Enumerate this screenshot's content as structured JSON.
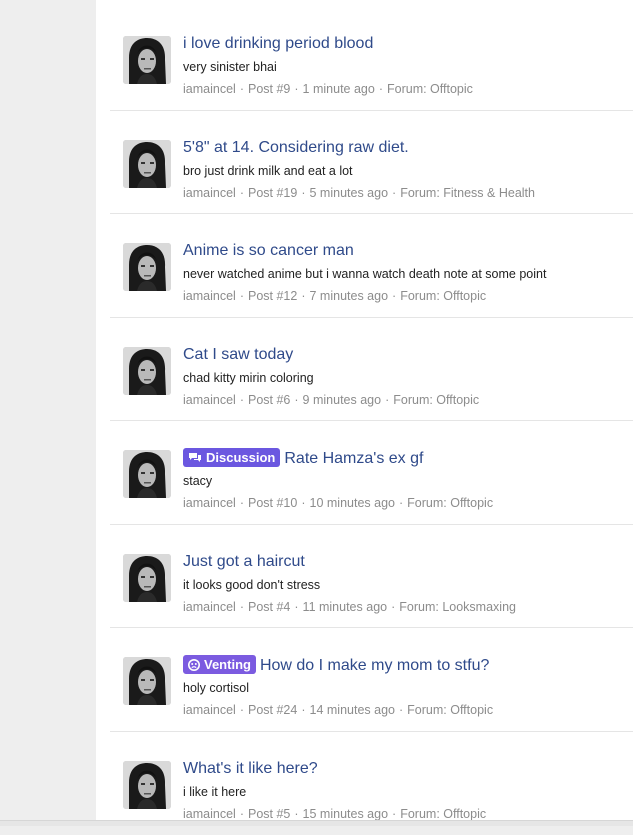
{
  "badge_colors": {
    "discussion": "#6b57e0",
    "venting": "#7b5be0"
  },
  "posts": [
    {
      "title": "i love drinking period blood",
      "snippet": "very sinister bhai",
      "author": "iamaincel",
      "post_number": "Post #9",
      "time": "1 minute ago",
      "forum": "Forum: Offtopic"
    },
    {
      "title": "5'8\" at 14. Considering raw diet.",
      "snippet": "bro just drink milk and eat a lot",
      "author": "iamaincel",
      "post_number": "Post #19",
      "time": "5 minutes ago",
      "forum": "Forum: Fitness & Health"
    },
    {
      "title": "Anime is so cancer man",
      "snippet": "never watched anime but i wanna watch death note at some point",
      "author": "iamaincel",
      "post_number": "Post #12",
      "time": "7 minutes ago",
      "forum": "Forum: Offtopic"
    },
    {
      "title": "Cat I saw today",
      "snippet": "chad kitty mirin coloring",
      "author": "iamaincel",
      "post_number": "Post #6",
      "time": "9 minutes ago",
      "forum": "Forum: Offtopic"
    },
    {
      "badge": "Discussion",
      "badge_icon": "speech-bubbles-icon",
      "title": "Rate Hamza's ex gf",
      "snippet": "stacy",
      "author": "iamaincel",
      "post_number": "Post #10",
      "time": "10 minutes ago",
      "forum": "Forum: Offtopic"
    },
    {
      "title": "Just got a haircut",
      "snippet": "it looks good don't stress",
      "author": "iamaincel",
      "post_number": "Post #4",
      "time": "11 minutes ago",
      "forum": "Forum: Looksmaxing"
    },
    {
      "badge": "Venting",
      "badge_icon": "angry-face-icon",
      "title": "How do I make my mom to stfu?",
      "snippet": "holy cortisol",
      "author": "iamaincel",
      "post_number": "Post #24",
      "time": "14 minutes ago",
      "forum": "Forum: Offtopic"
    },
    {
      "title": "What's it like here?",
      "snippet": "i like it here",
      "author": "iamaincel",
      "post_number": "Post #5",
      "time": "15 minutes ago",
      "forum": "Forum: Offtopic"
    }
  ]
}
